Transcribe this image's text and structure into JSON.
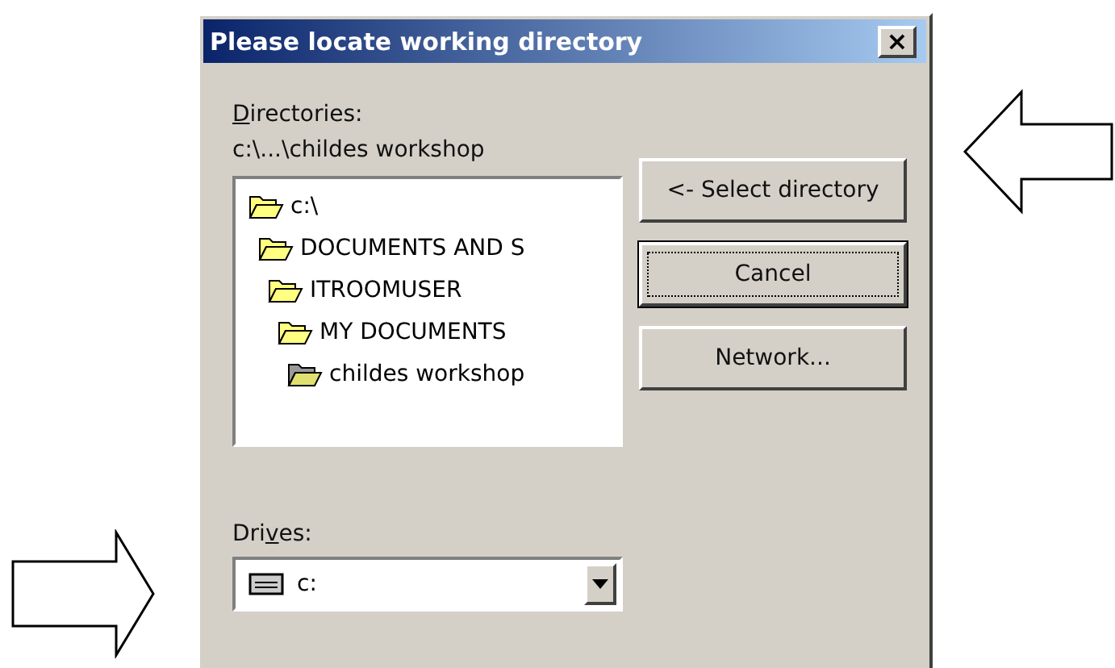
{
  "window": {
    "title": "Please locate working directory",
    "close": "×"
  },
  "directories": {
    "access_key": "D",
    "label_after": "irectories:",
    "path": "c:\\...\\childes workshop",
    "tree": [
      {
        "label": "c:\\",
        "selected": false,
        "children": [
          {
            "label": "DOCUMENTS AND S",
            "selected": false,
            "children": [
              {
                "label": "ITROOMUSER",
                "selected": false,
                "children": [
                  {
                    "label": "MY DOCUMENTS",
                    "selected": false,
                    "children": [
                      {
                        "label": "childes workshop",
                        "selected": true
                      }
                    ]
                  }
                ]
              }
            ]
          }
        ]
      }
    ]
  },
  "buttons": [
    {
      "label": "<- Select directory",
      "default": false
    },
    {
      "label": "Cancel",
      "default": true
    },
    {
      "label": "Network...",
      "default": false
    }
  ],
  "drives": {
    "label_before": "Dri",
    "access_key": "v",
    "label_after": "es:",
    "value": "c:"
  },
  "annotations": [
    {
      "kind": "left-arrow"
    },
    {
      "kind": "right-arrow"
    }
  ]
}
